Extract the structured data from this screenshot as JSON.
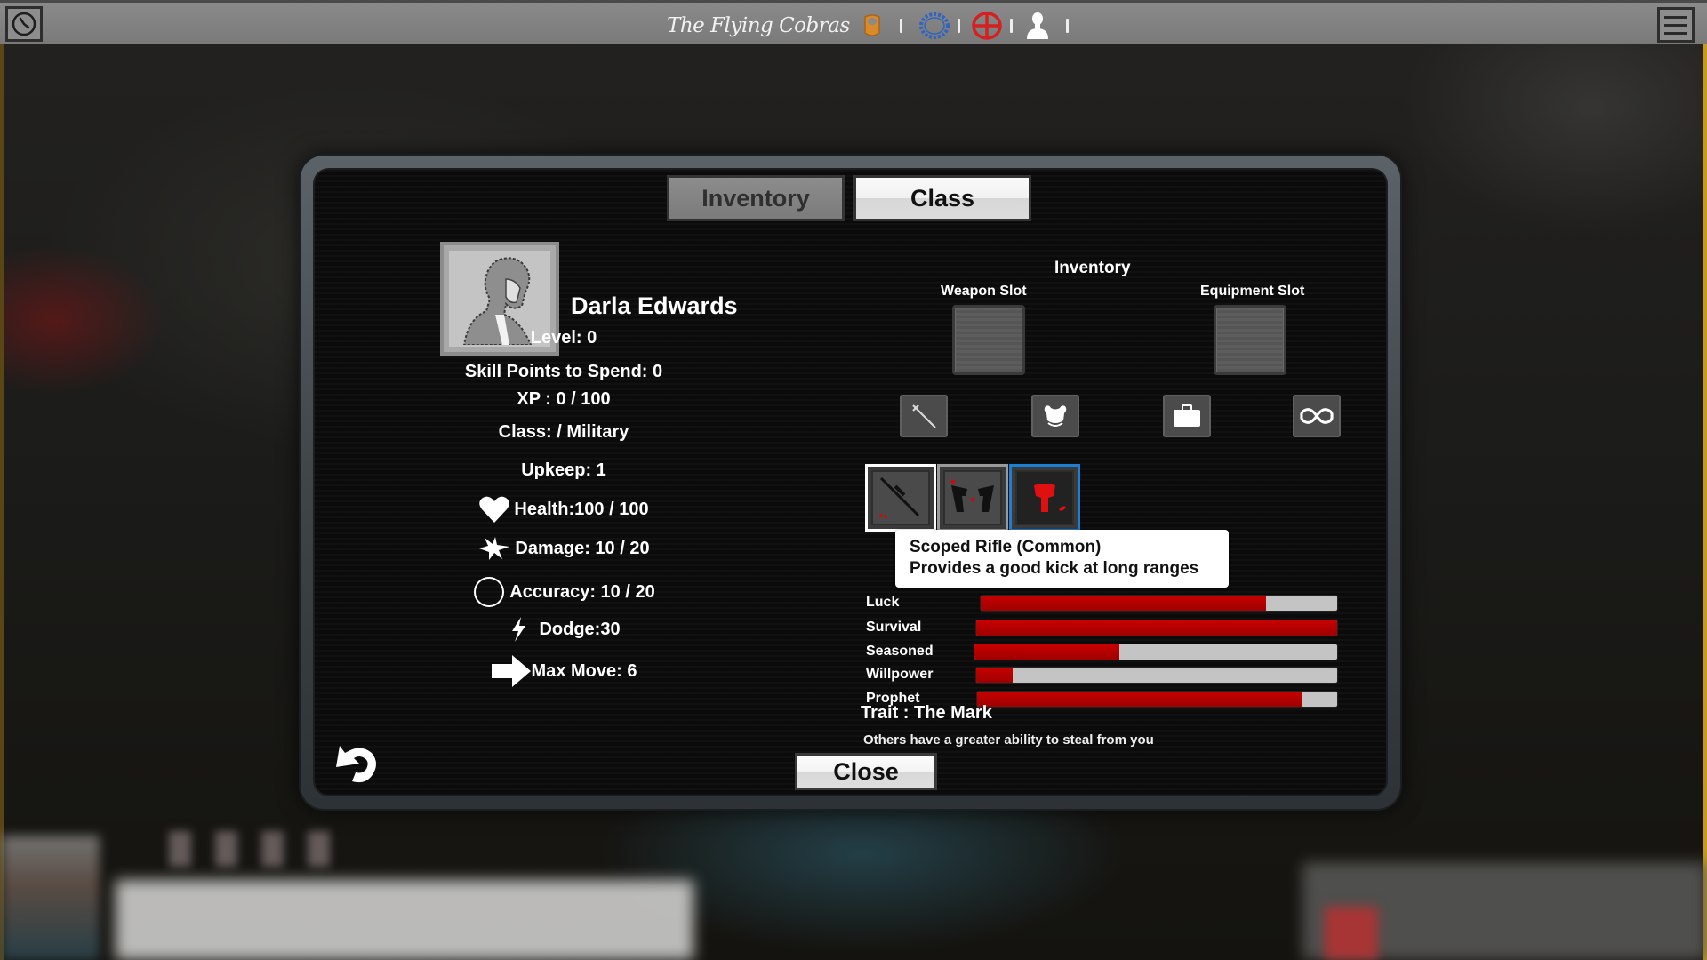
{
  "topbar": {
    "team_name": "The Flying Cobras",
    "icons": [
      "shield-icon",
      "gear-badge-icon",
      "crosshair-badge-icon",
      "person-icon"
    ],
    "separator": "|",
    "left_icon": "clock-icon",
    "right_icon": "hamburger-menu-icon"
  },
  "tabs": [
    {
      "label": "Inventory",
      "active": false
    },
    {
      "label": "Class",
      "active": true
    }
  ],
  "character": {
    "name": "Darla Edwards",
    "level": "Level: 0",
    "skill_points": "Skill Points to Spend: 0",
    "xp": "XP : 0 / 100",
    "class": "Class: / Military",
    "upkeep": "Upkeep: 1",
    "stats": [
      {
        "icon": "heart-icon",
        "label": "Health:100 / 100"
      },
      {
        "icon": "explosion-icon",
        "label": "Damage: 10 / 20"
      },
      {
        "icon": "circle-target-icon",
        "label": "Accuracy: 10 / 20"
      },
      {
        "icon": "lightning-icon",
        "label": "Dodge:30"
      },
      {
        "icon": "arrow-right-icon",
        "label": "Max Move: 6"
      }
    ]
  },
  "inventory": {
    "title": "Inventory",
    "weapon_slot_label": "Weapon Slot",
    "equipment_slot_label": "Equipment Slot",
    "filters": [
      "sword-icon",
      "armor-icon",
      "briefcase-icon",
      "infinity-icon"
    ],
    "items": [
      {
        "name": "Scoped Rifle",
        "icon": "rifle-icon",
        "state": "selected"
      },
      {
        "name": "Dual Pistols",
        "icon": "pistols-icon",
        "state": "normal"
      },
      {
        "name": "Armor Vest",
        "icon": "vest-icon",
        "state": "hover"
      }
    ],
    "tooltip": {
      "title": "Scoped Rifle (Common)",
      "description": "Provides a good kick at long ranges"
    }
  },
  "skills": [
    {
      "label": "Luck",
      "value": 0.8
    },
    {
      "label": "Survival",
      "value": 1.0
    },
    {
      "label": "Seasoned",
      "value": 0.4
    },
    {
      "label": "Willpower",
      "value": 0.1
    },
    {
      "label": "Prophet",
      "value": 0.9
    }
  ],
  "trait": {
    "title": "Trait : The Mark",
    "description": "Others have a greater ability to steal from you"
  },
  "buttons": {
    "close": "Close",
    "back_icon": "undo-arrow-icon"
  },
  "colors": {
    "bar_fill": "#b30000",
    "bar_track": "#c4c4c4",
    "hover_border": "#1c7fd6",
    "shield": "#d98a2b",
    "gear": "#2f64c2",
    "crosshair": "#d42020"
  }
}
